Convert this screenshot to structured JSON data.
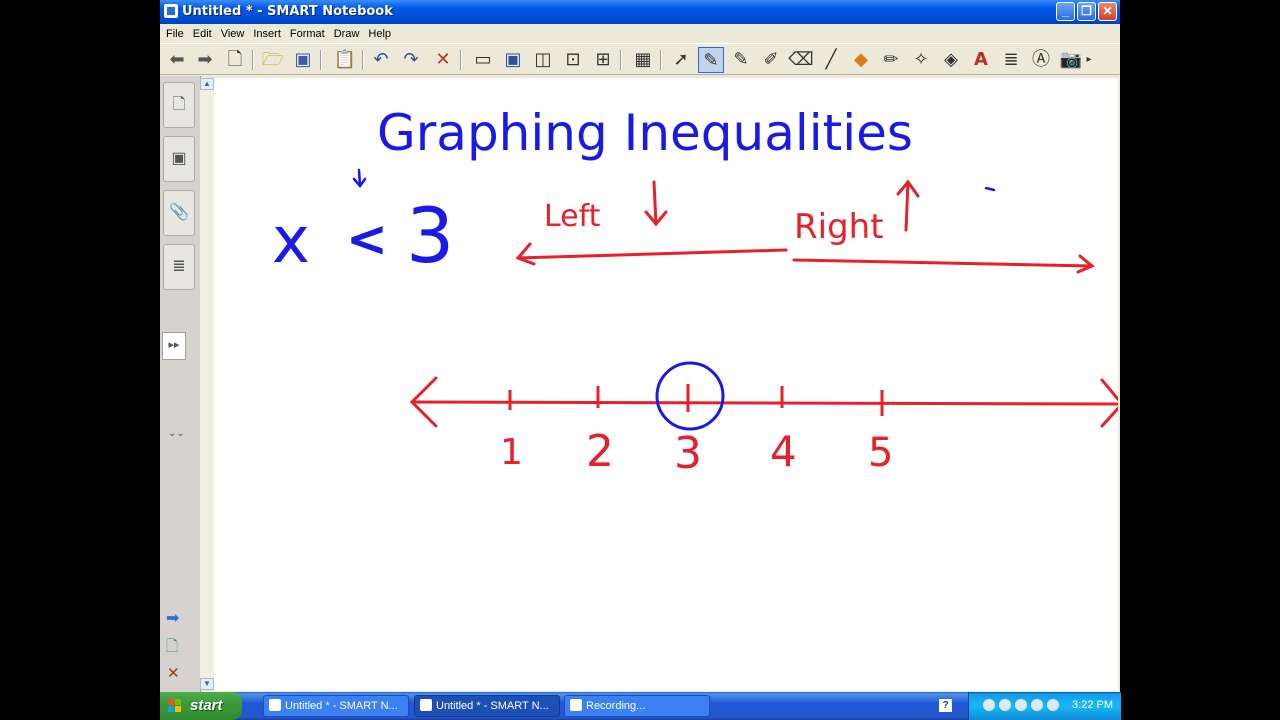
{
  "window": {
    "title": "Untitled * - SMART Notebook",
    "controls": [
      "minimize",
      "maximize",
      "close"
    ]
  },
  "menu": [
    "File",
    "Edit",
    "View",
    "Insert",
    "Format",
    "Draw",
    "Help"
  ],
  "toolbar": {
    "icons": [
      "back-icon",
      "forward-icon",
      "new-page-icon",
      "open-icon",
      "save-icon",
      "paste-icon",
      "undo-icon",
      "redo-icon",
      "delete-icon",
      "screen-shade-icon",
      "full-screen-icon",
      "dual-page-icon",
      "capture-icon",
      "table-tool-icon",
      "select-icon",
      "pen-icon",
      "creative-pen-icon",
      "highlighter-icon",
      "eraser-icon",
      "line-icon",
      "shape-icon",
      "magic-pen-icon",
      "shape-recognition-icon",
      "fill-icon",
      "text-icon",
      "properties-icon",
      "camera-icon"
    ]
  },
  "canvas": {
    "title": "Graphing Inequalities",
    "expression": {
      "variable": "x",
      "operator": "<",
      "value": "3"
    },
    "left_note": "Left",
    "right_note": "Right",
    "number_line": {
      "tick_labels": [
        "1",
        "2",
        "3",
        "4",
        "5"
      ],
      "circled": "3"
    },
    "colors": {
      "blue": "#1a1ae6",
      "red": "#e8202a"
    }
  },
  "taskbar": {
    "start_label": "start",
    "tasks": [
      "Untitled * - SMART N...",
      "Untitled * - SMART N...",
      "Recording..."
    ],
    "clock": "3:22 PM"
  }
}
